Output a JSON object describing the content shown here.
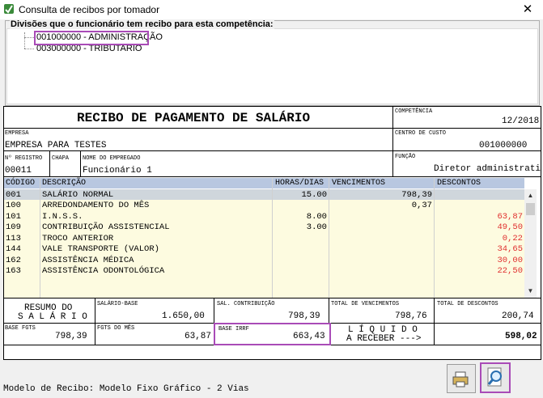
{
  "window": {
    "title": "Consulta de recibos por tomador",
    "close_glyph": "✕"
  },
  "divisions": {
    "label": "Divisões que o funcionário tem recibo para esta competência:",
    "items": [
      "001000000 - ADMINISTRAÇÃO",
      "003000000 - TRIBUTARIO"
    ]
  },
  "receipt": {
    "title": "RECIBO DE PAGAMENTO DE SALÁRIO",
    "competencia_label": "COMPETÊNCIA",
    "competencia": "12/2018",
    "empresa_label": "EMPRESA",
    "empresa": "EMPRESA PARA TESTES",
    "centro_custo_label": "CENTRO DE CUSTO",
    "centro_custo": "001000000",
    "registro_label": "Nº REGISTRO",
    "registro": "00011",
    "chapa_label": "CHAPA",
    "chapa": "",
    "nome_label": "NOME DO EMPREGADO",
    "nome": "Funcionário 1",
    "funcao_label": "FUNÇÃO",
    "funcao": "Diretor administrati",
    "columns": {
      "codigo": "CÓDIGO",
      "descricao": "DESCRIÇÃO",
      "horas": "HORAS/DIAS",
      "vencimentos": "VENCIMENTOS",
      "descontos": "DESCONTOS"
    },
    "rows": [
      {
        "codigo": "001",
        "descricao": "SALÁRIO NORMAL",
        "horas": "15.00",
        "vencimentos": "798,39",
        "descontos": ""
      },
      {
        "codigo": "100",
        "descricao": "ARREDONDAMENTO DO MÊS",
        "horas": "",
        "vencimentos": "0,37",
        "descontos": ""
      },
      {
        "codigo": "101",
        "descricao": "I.N.S.S.",
        "horas": "8.00",
        "vencimentos": "",
        "descontos": "63,87"
      },
      {
        "codigo": "109",
        "descricao": "CONTRIBUIÇÃO ASSISTENCIAL",
        "horas": "3.00",
        "vencimentos": "",
        "descontos": "49,50"
      },
      {
        "codigo": "113",
        "descricao": "TROCO ANTERIOR",
        "horas": "",
        "vencimentos": "",
        "descontos": "0,22"
      },
      {
        "codigo": "144",
        "descricao": "VALE TRANSPORTE (VALOR)",
        "horas": "",
        "vencimentos": "",
        "descontos": "34,65"
      },
      {
        "codigo": "162",
        "descricao": "ASSISTÊNCIA MÉDICA",
        "horas": "",
        "vencimentos": "",
        "descontos": "30,00"
      },
      {
        "codigo": "163",
        "descricao": "ASSISTÊNCIA ODONTOLÓGICA",
        "horas": "",
        "vencimentos": "",
        "descontos": "22,50"
      }
    ],
    "summary": {
      "resumo_line1": "RESUMO DO",
      "resumo_line2": "S A L Á R I O",
      "salario_base_label": "SALÁRIO-BASE",
      "salario_base": "1.650,00",
      "sal_contrib_label": "SAL. CONTRIBUIÇÃO",
      "sal_contrib": "798,39",
      "total_venc_label": "TOTAL DE VENCIMENTOS",
      "total_venc": "798,76",
      "total_desc_label": "TOTAL DE DESCONTOS",
      "total_desc": "200,74",
      "base_fgts_label": "BASE FGTS",
      "base_fgts": "798,39",
      "fgts_mes_label": "FGTS DO MÊS",
      "fgts_mes": "63,87",
      "base_irrf_label": "BASE IRRF",
      "base_irrf": "663,43",
      "liquido_line1": "L Í Q U I D O",
      "liquido_line2": "A RECEBER --->",
      "liquido": "598,02"
    }
  },
  "footer": {
    "model_text": "Modelo de Recibo: Modelo Fixo Gráfico - 2 Vias"
  },
  "colors": {
    "highlight": "#a94bb7",
    "discount_red": "#e03030",
    "grid_header": "#b8c7e0",
    "grid_body": "#fdfbe0"
  }
}
